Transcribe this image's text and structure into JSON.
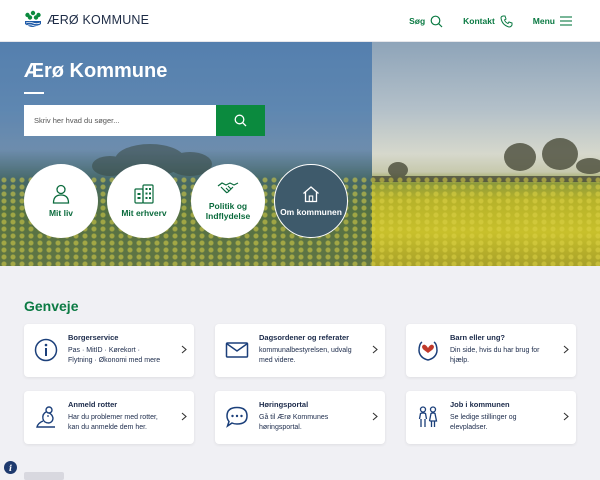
{
  "header": {
    "logo_text": "ÆRØ KOMMUNE",
    "nav": {
      "search": "Søg",
      "contact": "Kontakt",
      "menu": "Menu"
    }
  },
  "hero": {
    "title": "Ærø Kommune",
    "search_placeholder": "Skriv her hvad du søger...",
    "circles": [
      {
        "label_1": "Mit liv",
        "label_2": "",
        "icon": "person-icon"
      },
      {
        "label_1": "Mit erhverv",
        "label_2": "",
        "icon": "business-icon"
      },
      {
        "label_1": "Politik og",
        "label_2": "Indflydelse",
        "icon": "handshake-icon"
      },
      {
        "label_1": "Om kommunen",
        "label_2": "",
        "icon": "home-icon"
      }
    ]
  },
  "shortcuts": {
    "title": "Genveje",
    "cards": [
      {
        "title": "Borgerservice",
        "desc_1": "Pas · MitID · Kørekort ·",
        "desc_2": "Flytning · Økonomi med mere",
        "icon": "info-icon"
      },
      {
        "title": "Dagsordener og referater",
        "desc_1": "kommunalbestyrelsen, udvalg",
        "desc_2": "med videre.",
        "icon": "mail-icon"
      },
      {
        "title": "Barn eller ung?",
        "desc_1": "Din side, hvis du har brug for",
        "desc_2": "hjælp.",
        "icon": "hand-heart-icon"
      },
      {
        "title": "Anmeld rotter",
        "desc_1": "Har du problemer med rotter,",
        "desc_2": "kan du anmelde dem her.",
        "icon": "rat-icon"
      },
      {
        "title": "Høringsportal",
        "desc_1": "Gå til Ærø Kommunes",
        "desc_2": "høringsportal.",
        "icon": "speech-bubble-icon"
      },
      {
        "title": "Job i kommunen",
        "desc_1": "Se ledige stillinger og",
        "desc_2": "elevpladser.",
        "icon": "people-icon"
      }
    ]
  },
  "colors": {
    "brand_green": "#0b7a43",
    "button_green": "#0b8a3e",
    "card_icon_blue": "#1b3f7a"
  }
}
